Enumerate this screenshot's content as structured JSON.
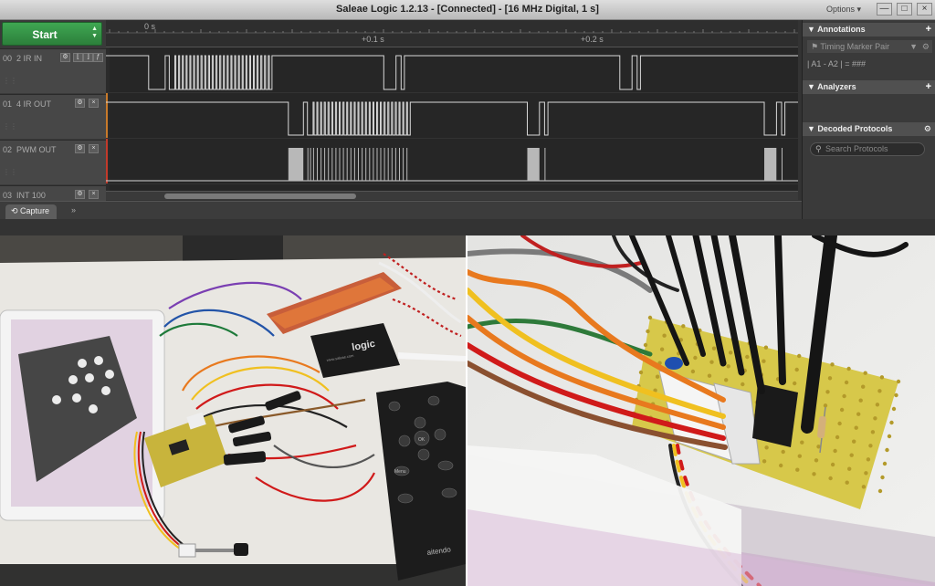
{
  "window": {
    "title": "Saleae Logic 1.2.13 - [Connected] - [16 MHz Digital, 1 s]",
    "options_label": "Options ▾",
    "minimize": "—",
    "maximize": "□",
    "close": "×"
  },
  "start_button": {
    "label": "Start",
    "arrows": "▲\n▼"
  },
  "channels": [
    {
      "num": "00",
      "name": "2 IR IN"
    },
    {
      "num": "01",
      "name": "4 IR OUT"
    },
    {
      "num": "02",
      "name": "PWM OUT"
    },
    {
      "num": "03",
      "name": "INT 100"
    }
  ],
  "timeline": {
    "ticks": [
      "0 s",
      "+0.1 s",
      "+0.2 s"
    ]
  },
  "signals": {
    "ir_in": [
      [
        0,
        1
      ],
      [
        0.0617,
        1
      ],
      [
        0.0617,
        0
      ],
      [
        0.0856,
        0
      ],
      [
        0.0856,
        1
      ],
      [
        0.0915,
        1
      ],
      [
        0.0915,
        0
      ],
      [
        0.0996,
        0
      ],
      [
        0.0996,
        1
      ],
      [
        0.1011,
        1
      ],
      [
        0.1011,
        0
      ],
      [
        0.105,
        0
      ],
      [
        0.105,
        1
      ],
      [
        0.1065,
        1
      ],
      [
        0.1065,
        0
      ],
      [
        0.1104,
        0
      ],
      [
        0.1104,
        1
      ],
      [
        0.1119,
        1
      ],
      [
        0.1119,
        0
      ],
      [
        0.1158,
        0
      ],
      [
        0.1158,
        1
      ],
      [
        0.1173,
        1
      ],
      [
        0.1173,
        0
      ],
      [
        0.1212,
        0
      ],
      [
        0.1212,
        1
      ],
      [
        0.1227,
        1
      ],
      [
        0.1227,
        0
      ],
      [
        0.1266,
        0
      ],
      [
        0.1266,
        1
      ],
      [
        0.1281,
        1
      ],
      [
        0.1281,
        0
      ],
      [
        0.132,
        0
      ],
      [
        0.132,
        1
      ],
      [
        0.1335,
        1
      ],
      [
        0.1335,
        0
      ],
      [
        0.1374,
        0
      ],
      [
        0.1374,
        1
      ],
      [
        0.1389,
        1
      ],
      [
        0.1389,
        0
      ],
      [
        0.1428,
        0
      ],
      [
        0.1428,
        1
      ],
      [
        0.1443,
        1
      ],
      [
        0.1443,
        0
      ],
      [
        0.1482,
        0
      ],
      [
        0.1482,
        1
      ],
      [
        0.1497,
        1
      ],
      [
        0.1497,
        0
      ],
      [
        0.1536,
        0
      ],
      [
        0.1536,
        1
      ],
      [
        0.1551,
        1
      ],
      [
        0.1551,
        0
      ],
      [
        0.159,
        0
      ],
      [
        0.159,
        1
      ],
      [
        0.1605,
        1
      ],
      [
        0.1605,
        0
      ],
      [
        0.1644,
        0
      ],
      [
        0.1644,
        1
      ],
      [
        0.1659,
        1
      ],
      [
        0.1659,
        0
      ],
      [
        0.1698,
        0
      ],
      [
        0.1698,
        1
      ],
      [
        0.1713,
        1
      ],
      [
        0.1713,
        0
      ],
      [
        0.1752,
        0
      ],
      [
        0.1752,
        1
      ],
      [
        0.1767,
        1
      ],
      [
        0.1767,
        0
      ],
      [
        0.1806,
        0
      ],
      [
        0.1806,
        1
      ],
      [
        0.1821,
        1
      ],
      [
        0.1821,
        0
      ],
      [
        0.186,
        0
      ],
      [
        0.186,
        1
      ],
      [
        0.1875,
        1
      ],
      [
        0.1875,
        0
      ],
      [
        0.1914,
        0
      ],
      [
        0.1914,
        1
      ],
      [
        0.1929,
        1
      ],
      [
        0.1929,
        0
      ],
      [
        0.1968,
        0
      ],
      [
        0.1968,
        1
      ],
      [
        0.1983,
        1
      ],
      [
        0.1983,
        0
      ],
      [
        0.2022,
        0
      ],
      [
        0.2022,
        1
      ],
      [
        0.2037,
        1
      ],
      [
        0.2037,
        0
      ],
      [
        0.2076,
        0
      ],
      [
        0.2076,
        1
      ],
      [
        0.2091,
        1
      ],
      [
        0.2091,
        0
      ],
      [
        0.213,
        0
      ],
      [
        0.213,
        1
      ],
      [
        0.2145,
        1
      ],
      [
        0.2145,
        0
      ],
      [
        0.2184,
        0
      ],
      [
        0.2184,
        1
      ],
      [
        0.2199,
        1
      ],
      [
        0.2199,
        0
      ],
      [
        0.2238,
        0
      ],
      [
        0.2238,
        1
      ],
      [
        0.2253,
        1
      ],
      [
        0.2253,
        0
      ],
      [
        0.2292,
        0
      ],
      [
        0.2292,
        1
      ],
      [
        0.2307,
        1
      ],
      [
        0.2307,
        0
      ],
      [
        0.2346,
        0
      ],
      [
        0.2346,
        1
      ],
      [
        0.2361,
        1
      ],
      [
        0.2361,
        0
      ],
      [
        0.24,
        0
      ],
      [
        0.24,
        1
      ],
      [
        0.4015,
        1
      ],
      [
        0.4015,
        0
      ],
      [
        0.4191,
        0
      ],
      [
        0.4191,
        1
      ],
      [
        0.4265,
        1
      ],
      [
        0.4265,
        0
      ],
      [
        0.4313,
        0
      ],
      [
        0.4313,
        1
      ],
      [
        0.7425,
        1
      ],
      [
        0.7425,
        0
      ],
      [
        0.7602,
        0
      ],
      [
        0.7602,
        1
      ],
      [
        0.7676,
        1
      ],
      [
        0.7676,
        0
      ],
      [
        0.7723,
        0
      ],
      [
        0.7723,
        1
      ],
      [
        1,
        1
      ]
    ],
    "ir_out": [
      [
        0,
        1
      ],
      [
        0.2636,
        1
      ],
      [
        0.2636,
        0
      ],
      [
        0.2853,
        0
      ],
      [
        0.2853,
        1
      ],
      [
        0.2912,
        1
      ],
      [
        0.2912,
        0
      ],
      [
        0.2993,
        0
      ],
      [
        0.2993,
        1
      ],
      [
        0.3008,
        1
      ],
      [
        0.3008,
        0
      ],
      [
        0.3047,
        0
      ],
      [
        0.3047,
        1
      ],
      [
        0.3062,
        1
      ],
      [
        0.3062,
        0
      ],
      [
        0.3101,
        0
      ],
      [
        0.3101,
        1
      ],
      [
        0.3116,
        1
      ],
      [
        0.3116,
        0
      ],
      [
        0.3155,
        0
      ],
      [
        0.3155,
        1
      ],
      [
        0.317,
        1
      ],
      [
        0.317,
        0
      ],
      [
        0.3209,
        0
      ],
      [
        0.3209,
        1
      ],
      [
        0.3224,
        1
      ],
      [
        0.3224,
        0
      ],
      [
        0.3263,
        0
      ],
      [
        0.3263,
        1
      ],
      [
        0.3278,
        1
      ],
      [
        0.3278,
        0
      ],
      [
        0.3317,
        0
      ],
      [
        0.3317,
        1
      ],
      [
        0.3332,
        1
      ],
      [
        0.3332,
        0
      ],
      [
        0.3371,
        0
      ],
      [
        0.3371,
        1
      ],
      [
        0.3386,
        1
      ],
      [
        0.3386,
        0
      ],
      [
        0.3425,
        0
      ],
      [
        0.3425,
        1
      ],
      [
        0.344,
        1
      ],
      [
        0.344,
        0
      ],
      [
        0.3479,
        0
      ],
      [
        0.3479,
        1
      ],
      [
        0.3494,
        1
      ],
      [
        0.3494,
        0
      ],
      [
        0.3533,
        0
      ],
      [
        0.3533,
        1
      ],
      [
        0.3548,
        1
      ],
      [
        0.3548,
        0
      ],
      [
        0.3587,
        0
      ],
      [
        0.3587,
        1
      ],
      [
        0.3602,
        1
      ],
      [
        0.3602,
        0
      ],
      [
        0.3641,
        0
      ],
      [
        0.3641,
        1
      ],
      [
        0.3656,
        1
      ],
      [
        0.3656,
        0
      ],
      [
        0.3695,
        0
      ],
      [
        0.3695,
        1
      ],
      [
        0.371,
        1
      ],
      [
        0.371,
        0
      ],
      [
        0.3749,
        0
      ],
      [
        0.3749,
        1
      ],
      [
        0.3764,
        1
      ],
      [
        0.3764,
        0
      ],
      [
        0.3803,
        0
      ],
      [
        0.3803,
        1
      ],
      [
        0.3818,
        1
      ],
      [
        0.3818,
        0
      ],
      [
        0.3857,
        0
      ],
      [
        0.3857,
        1
      ],
      [
        0.3872,
        1
      ],
      [
        0.3872,
        0
      ],
      [
        0.3911,
        0
      ],
      [
        0.3911,
        1
      ],
      [
        0.3926,
        1
      ],
      [
        0.3926,
        0
      ],
      [
        0.3965,
        0
      ],
      [
        0.3965,
        1
      ],
      [
        0.398,
        1
      ],
      [
        0.398,
        0
      ],
      [
        0.4019,
        0
      ],
      [
        0.4019,
        1
      ],
      [
        0.4034,
        1
      ],
      [
        0.4034,
        0
      ],
      [
        0.4073,
        0
      ],
      [
        0.4073,
        1
      ],
      [
        0.4088,
        1
      ],
      [
        0.4088,
        0
      ],
      [
        0.4127,
        0
      ],
      [
        0.4127,
        1
      ],
      [
        0.4142,
        1
      ],
      [
        0.4142,
        0
      ],
      [
        0.4181,
        0
      ],
      [
        0.4181,
        1
      ],
      [
        0.4196,
        1
      ],
      [
        0.4196,
        0
      ],
      [
        0.4235,
        0
      ],
      [
        0.4235,
        1
      ],
      [
        0.425,
        1
      ],
      [
        0.425,
        0
      ],
      [
        0.4289,
        0
      ],
      [
        0.4289,
        1
      ],
      [
        0.4304,
        1
      ],
      [
        0.4304,
        0
      ],
      [
        0.4343,
        0
      ],
      [
        0.4343,
        1
      ],
      [
        0.4358,
        1
      ],
      [
        0.4358,
        0
      ],
      [
        0.4397,
        0
      ],
      [
        0.4397,
        1
      ],
      [
        0.6088,
        1
      ],
      [
        0.6088,
        0
      ],
      [
        0.6264,
        0
      ],
      [
        0.6264,
        1
      ],
      [
        0.6338,
        1
      ],
      [
        0.6338,
        0
      ],
      [
        0.6386,
        0
      ],
      [
        0.6386,
        1
      ],
      [
        0.9512,
        1
      ],
      [
        0.9512,
        0
      ],
      [
        0.9688,
        0
      ],
      [
        0.9688,
        1
      ],
      [
        0.9762,
        1
      ],
      [
        0.9762,
        0
      ],
      [
        0.981,
        0
      ],
      [
        0.981,
        1
      ],
      [
        1,
        1
      ]
    ],
    "pwm_out": [
      [
        0.2636,
        0.2853
      ],
      [
        0.2912,
        0.2925
      ],
      [
        0.295,
        0.2963
      ],
      [
        0.2993,
        0.3006
      ],
      [
        0.3047,
        0.306
      ],
      [
        0.3101,
        0.3114
      ],
      [
        0.3155,
        0.3168
      ],
      [
        0.3209,
        0.3222
      ],
      [
        0.3263,
        0.3276
      ],
      [
        0.3317,
        0.333
      ],
      [
        0.3371,
        0.3384
      ],
      [
        0.3425,
        0.3438
      ],
      [
        0.3479,
        0.3492
      ],
      [
        0.3533,
        0.3546
      ],
      [
        0.3587,
        0.36
      ],
      [
        0.3641,
        0.3654
      ],
      [
        0.3695,
        0.3708
      ],
      [
        0.3749,
        0.3762
      ],
      [
        0.3803,
        0.3816
      ],
      [
        0.3857,
        0.387
      ],
      [
        0.3911,
        0.3924
      ],
      [
        0.3965,
        0.3978
      ],
      [
        0.4019,
        0.4032
      ],
      [
        0.4073,
        0.4086
      ],
      [
        0.4127,
        0.414
      ],
      [
        0.4181,
        0.4194
      ],
      [
        0.4235,
        0.4248
      ],
      [
        0.4289,
        0.4302
      ],
      [
        0.4343,
        0.4356
      ],
      [
        0.6088,
        0.6264
      ],
      [
        0.6338,
        0.6351
      ],
      [
        0.9512,
        0.9688
      ],
      [
        0.9762,
        0.9775
      ]
    ]
  },
  "bottom": {
    "capture_tab": "Capture",
    "chevron": "»"
  },
  "right_panel": {
    "annotations": "Annotations",
    "timing_marker": "Timing Marker Pair",
    "marker_eq": "| A1 - A2 | = ###",
    "analyzers": "Analyzers",
    "decoded": "Decoded Protocols",
    "search_placeholder": "Search Protocols",
    "plus": "+"
  },
  "photo_text": {
    "saleae_logo": "logic",
    "saleae_url": "www.saleae.com",
    "remote_brand": "aitendo",
    "remote_menu": "Menu",
    "remote_ok": "OK",
    "remote_stop": "■",
    "remote_prev": "⏮",
    "remote_next": "⏭"
  },
  "colors": {
    "start_green": "#2e8a3f",
    "wave": "#d8d8d8",
    "wire_red": "#d01a1a",
    "wire_yellow": "#f0c020",
    "wire_orange": "#e8791e",
    "board_yellow": "#d7c84a"
  }
}
